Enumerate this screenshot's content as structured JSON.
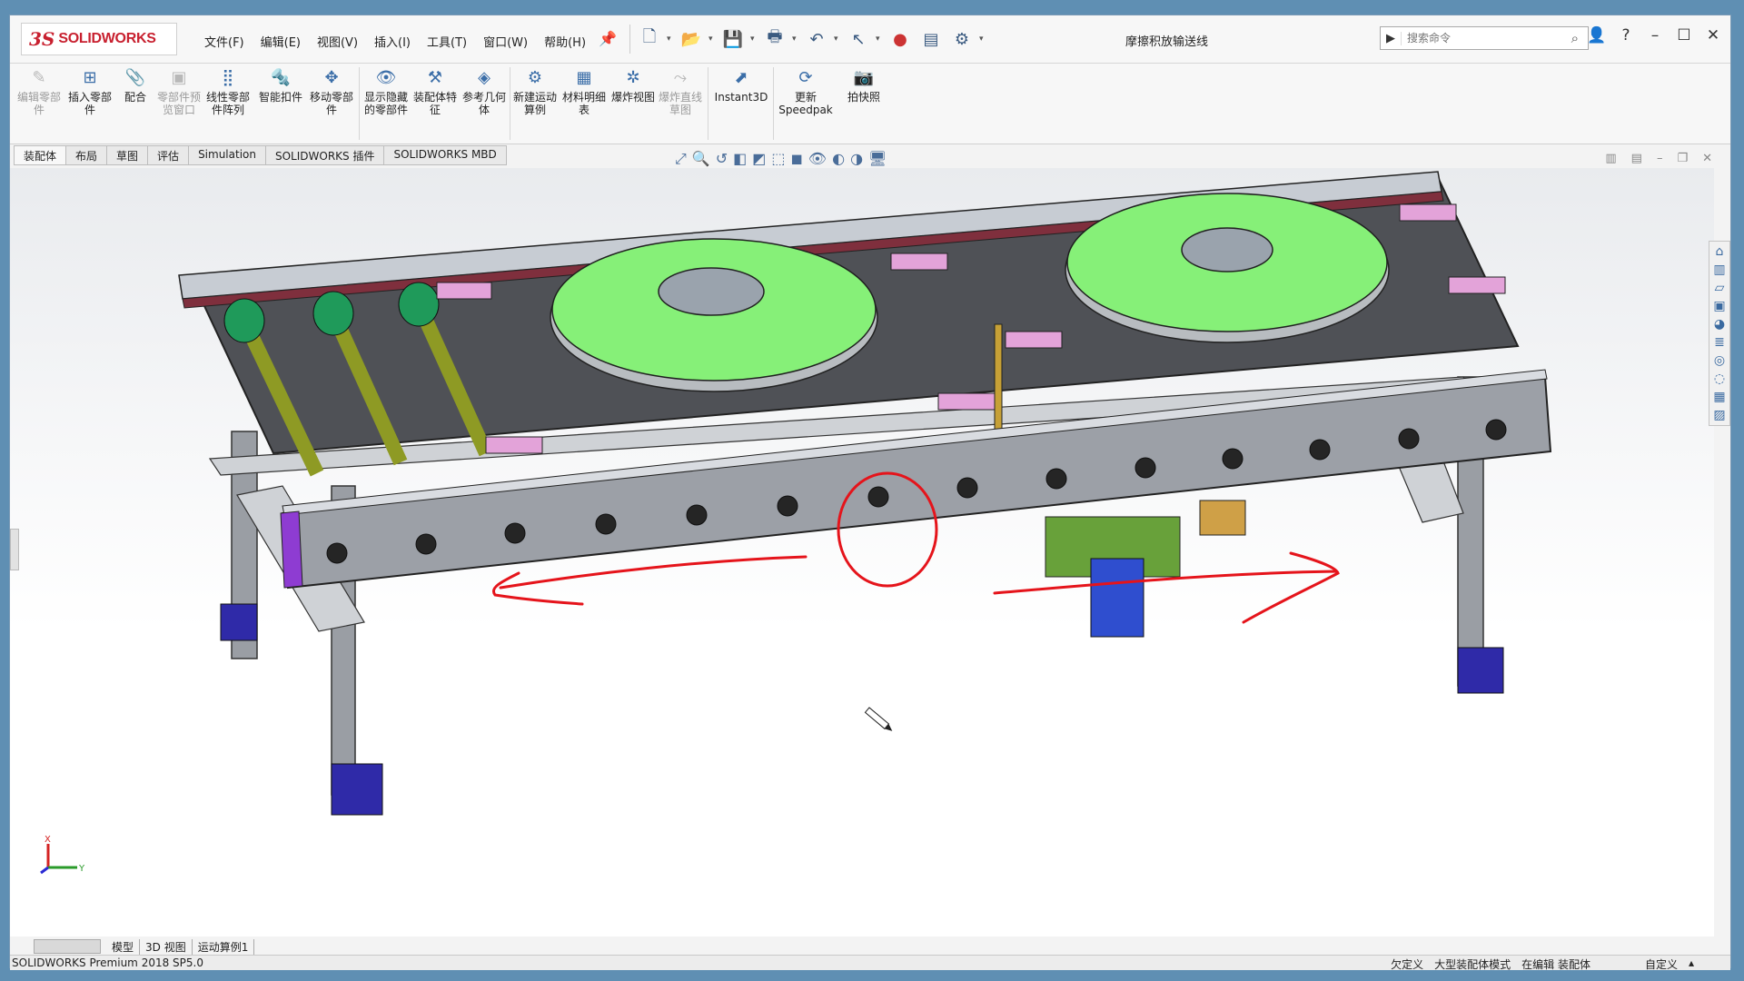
{
  "app": {
    "brand_ds": "3S",
    "brand_name": "SOLIDWORKS",
    "doc_title": "摩擦积放输送线"
  },
  "menu": [
    "文件(F)",
    "编辑(E)",
    "视图(V)",
    "插入(I)",
    "工具(T)",
    "窗口(W)",
    "帮助(H)"
  ],
  "search": {
    "placeholder": "搜索命令"
  },
  "toolbar": {
    "edit_component": "编辑零部件",
    "insert_component": "插入零部件",
    "mate": "配合",
    "component_preview": "零部件预览窗口",
    "linear_pattern": "线性零部件阵列",
    "smart_fasteners": "智能扣件",
    "move_component": "移动零部件",
    "show_hidden": "显示隐藏的零部件",
    "assembly_features": "装配体特征",
    "reference_geometry": "参考几何体",
    "new_motion_study": "新建运动算例",
    "bom": "材料明细表",
    "exploded_view": "爆炸视图",
    "explode_line_sketch": "爆炸直线草图",
    "instant3d": "Instant3D",
    "update_speedpak": "更新 Speedpak",
    "snapshot": "拍快照"
  },
  "tabs": [
    "装配体",
    "布局",
    "草图",
    "评估",
    "Simulation",
    "SOLIDWORKS 插件",
    "SOLIDWORKS MBD"
  ],
  "bottom_tabs": [
    "模型",
    "3D 视图",
    "运动算例1"
  ],
  "status": {
    "product": "SOLIDWORKS Premium 2018 SP5.0",
    "under_defined": "欠定义",
    "large_assembly": "大型装配体模式",
    "editing": "在编辑 装配体",
    "custom": "自定义"
  },
  "axis": {
    "x": "X",
    "y": "Y"
  }
}
